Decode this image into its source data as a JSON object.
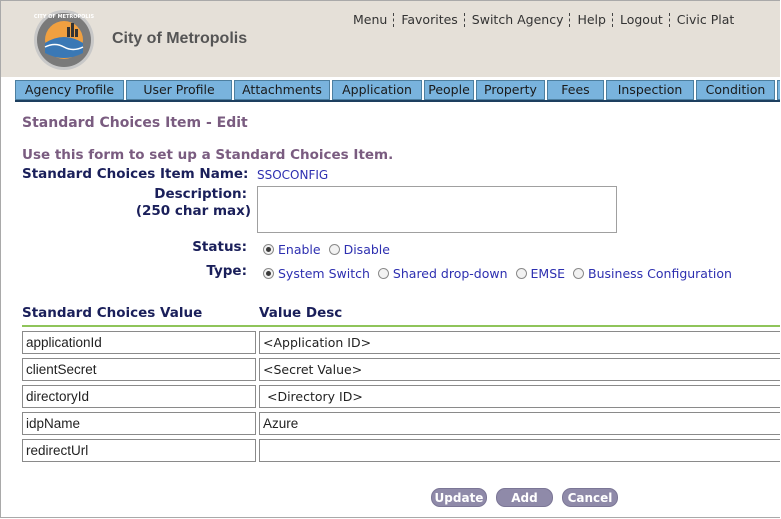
{
  "header": {
    "city_name": "City of Metropolis",
    "logo_text": "CITY OF METROPOLIS",
    "nav": [
      "Menu",
      "Favorites",
      "Switch Agency",
      "Help",
      "Logout",
      "Civic Plat"
    ]
  },
  "tabs": [
    "Agency Profile",
    "User Profile",
    "Attachments",
    "Application",
    "People",
    "Property",
    "Fees",
    "Inspection",
    "Condition"
  ],
  "page": {
    "title": "Standard Choices Item - Edit",
    "intro": "Use this form to set up a Standard Choices Item.",
    "item_name_label": "Standard Choices Item Name:",
    "item_name_value": "SSOCONFIG",
    "description_label_1": "Description:",
    "description_label_2": "(250 char max)",
    "description_value": "",
    "status_label": "Status:",
    "status_options": [
      "Enable",
      "Disable"
    ],
    "type_label": "Type:",
    "type_options": [
      "System Switch",
      "Shared drop-down",
      "EMSE",
      "Business Configuration"
    ]
  },
  "grid": {
    "col_value": "Standard Choices Value",
    "col_desc": "Value Desc",
    "rows": [
      {
        "value": "applicationId",
        "desc": "<Application ID>"
      },
      {
        "value": "clientSecret",
        "desc": "<Secret Value>"
      },
      {
        "value": "directoryId",
        "desc": " <Directory ID>"
      },
      {
        "value": "idpName",
        "desc": "Azure"
      },
      {
        "value": "redirectUrl",
        "desc": ""
      }
    ]
  },
  "buttons": {
    "update": "Update",
    "add": "Add",
    "cancel": "Cancel"
  },
  "colors": {
    "tab_bg": "#79b3dd",
    "header_bg": "#e5e0d8",
    "title_purple": "#7a5c80",
    "label_navy": "#1a1f5a",
    "link_blue": "#2d2fb0",
    "button": "#8f8aa9",
    "rule_green": "#8fc45a"
  }
}
